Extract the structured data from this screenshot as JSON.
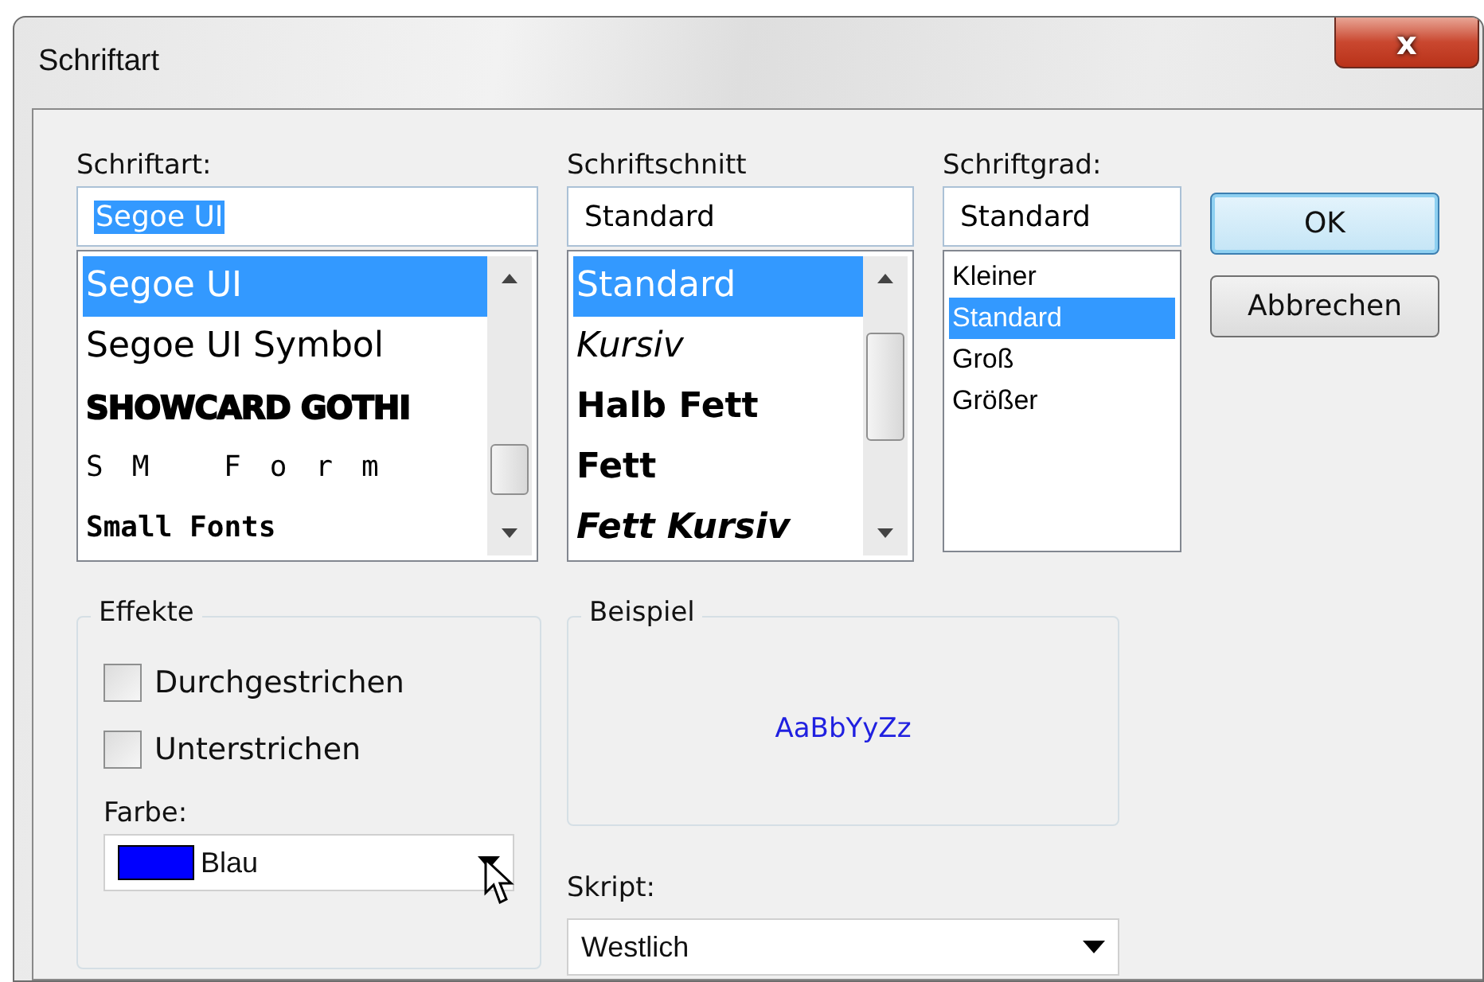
{
  "window": {
    "title": "Schriftart",
    "close": "x"
  },
  "font": {
    "label": "Schriftart:",
    "value": "Segoe UI",
    "value_selected": true,
    "items": [
      {
        "label": "Segoe UI",
        "selected": true,
        "kind": "regular"
      },
      {
        "label": "Segoe UI Symbol",
        "selected": false,
        "kind": "regular"
      },
      {
        "label": "SHOWCARD GOTHI",
        "selected": false,
        "kind": "heavy"
      },
      {
        "label": "SM Form",
        "selected": false,
        "kind": "spaced"
      },
      {
        "label": "Small Fonts",
        "selected": false,
        "kind": "pixel"
      }
    ]
  },
  "style": {
    "label": "Schriftschnitt",
    "value": "Standard",
    "items": [
      {
        "label": "Standard",
        "selected": true,
        "kind": "regular"
      },
      {
        "label": "Kursiv",
        "selected": false,
        "kind": "italic"
      },
      {
        "label": "Halb Fett",
        "selected": false,
        "kind": "semibold"
      },
      {
        "label": "Fett",
        "selected": false,
        "kind": "bold"
      },
      {
        "label": "Fett Kursiv",
        "selected": false,
        "kind": "bolditalic"
      }
    ]
  },
  "size": {
    "label": "Schriftgrad:",
    "value": "Standard",
    "items": [
      {
        "label": "Kleiner",
        "selected": false
      },
      {
        "label": "Standard",
        "selected": true
      },
      {
        "label": "Groß",
        "selected": false
      },
      {
        "label": "Größer",
        "selected": false
      }
    ]
  },
  "buttons": [
    {
      "label": "OK",
      "default": true
    },
    {
      "label": "Abbrechen",
      "default": false
    }
  ],
  "effects": {
    "title": "Effekte",
    "options": [
      {
        "label": "Durchgestrichen",
        "checked": false
      },
      {
        "label": "Unterstrichen",
        "checked": false
      }
    ],
    "color_label": "Farbe:",
    "color": {
      "name": "Blau",
      "color": "#0000ff"
    }
  },
  "preview": {
    "title": "Beispiel",
    "text": "AaBbYyZz"
  },
  "script": {
    "label": "Skript:",
    "value": "Westlich"
  }
}
